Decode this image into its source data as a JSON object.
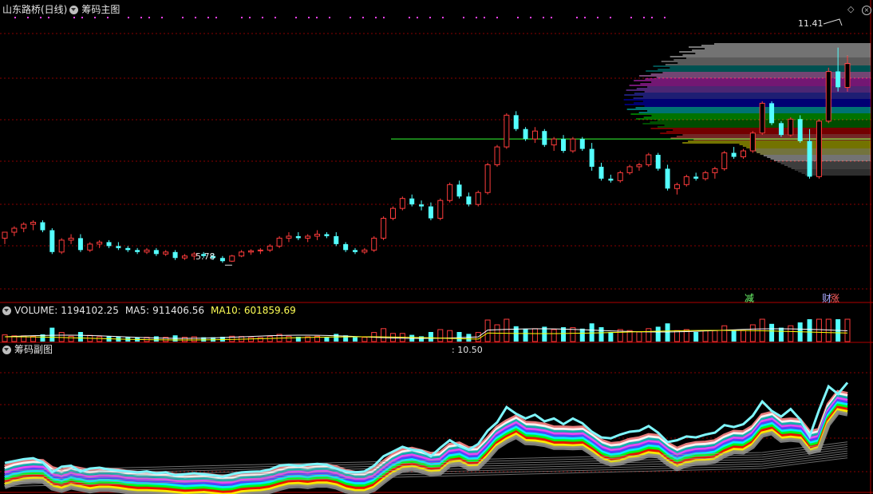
{
  "header": {
    "stock_name": "山东路桥(日线)",
    "main_indicator": "筹码主图",
    "price_high_label": "11.41",
    "price_low_label": "5.78",
    "signal_left": "减",
    "signal_right_a": "财",
    "signal_right_b": "涨"
  },
  "volume_panel": {
    "label_volume": "VOLUME:",
    "volume_value": "1194102.25",
    "label_ma5": "MA5:",
    "ma5_value": "911406.56",
    "label_ma10": "MA10:",
    "ma10_value": "601859.69"
  },
  "sub_panel": {
    "title": "筹码副图",
    "value_label": ": 10.50"
  },
  "colors": {
    "up": "#ff3c3c",
    "down": "#54ffff",
    "grid": "#8a0000",
    "border": "#b00000",
    "cyan_line": "#7ff7ff",
    "magenta_dots": "#ff40ff"
  },
  "chart_data": {
    "type": "candlestick",
    "y_range": [
      5.0,
      11.8
    ],
    "low_marker": 5.78,
    "high_marker": 11.41,
    "avg_cost_line": 8.9,
    "candles": [
      [
        6.4,
        6.55,
        6.25,
        6.55
      ],
      [
        6.55,
        6.7,
        6.45,
        6.65
      ],
      [
        6.65,
        6.8,
        6.55,
        6.75
      ],
      [
        6.75,
        6.85,
        6.6,
        6.8
      ],
      [
        6.8,
        6.85,
        6.55,
        6.6
      ],
      [
        6.6,
        6.65,
        6.0,
        6.05
      ],
      [
        6.05,
        6.4,
        6.0,
        6.35
      ],
      [
        6.35,
        6.5,
        6.25,
        6.4
      ],
      [
        6.4,
        6.5,
        6.05,
        6.1
      ],
      [
        6.1,
        6.3,
        6.05,
        6.25
      ],
      [
        6.25,
        6.35,
        6.15,
        6.3
      ],
      [
        6.3,
        6.35,
        6.15,
        6.2
      ],
      [
        6.2,
        6.3,
        6.1,
        6.15
      ],
      [
        6.15,
        6.2,
        6.05,
        6.1
      ],
      [
        6.1,
        6.15,
        6.0,
        6.05
      ],
      [
        6.05,
        6.15,
        6.0,
        6.1
      ],
      [
        6.1,
        6.15,
        5.95,
        6.0
      ],
      [
        6.0,
        6.1,
        5.95,
        6.05
      ],
      [
        6.05,
        6.1,
        5.85,
        5.9
      ],
      [
        5.9,
        6.0,
        5.85,
        5.95
      ],
      [
        5.95,
        6.05,
        5.85,
        6.0
      ],
      [
        6.0,
        6.05,
        5.9,
        5.95
      ],
      [
        5.95,
        6.0,
        5.85,
        5.9
      ],
      [
        5.9,
        5.95,
        5.78,
        5.82
      ],
      [
        5.82,
        5.98,
        5.8,
        5.95
      ],
      [
        5.95,
        6.1,
        5.92,
        6.05
      ],
      [
        6.05,
        6.12,
        5.98,
        6.08
      ],
      [
        6.08,
        6.15,
        6.0,
        6.1
      ],
      [
        6.1,
        6.25,
        6.05,
        6.2
      ],
      [
        6.2,
        6.45,
        6.15,
        6.4
      ],
      [
        6.4,
        6.55,
        6.3,
        6.45
      ],
      [
        6.45,
        6.55,
        6.35,
        6.4
      ],
      [
        6.4,
        6.5,
        6.3,
        6.45
      ],
      [
        6.45,
        6.6,
        6.35,
        6.5
      ],
      [
        6.5,
        6.55,
        6.4,
        6.45
      ],
      [
        6.45,
        6.55,
        6.2,
        6.25
      ],
      [
        6.25,
        6.3,
        6.05,
        6.1
      ],
      [
        6.1,
        6.15,
        6.0,
        6.05
      ],
      [
        6.05,
        6.15,
        6.0,
        6.1
      ],
      [
        6.1,
        6.45,
        6.05,
        6.4
      ],
      [
        6.4,
        6.95,
        6.35,
        6.9
      ],
      [
        6.9,
        7.2,
        6.85,
        7.15
      ],
      [
        7.15,
        7.45,
        7.1,
        7.4
      ],
      [
        7.4,
        7.5,
        7.2,
        7.25
      ],
      [
        7.25,
        7.35,
        7.1,
        7.2
      ],
      [
        7.2,
        7.3,
        6.85,
        6.9
      ],
      [
        6.9,
        7.4,
        6.85,
        7.35
      ],
      [
        7.35,
        7.8,
        7.3,
        7.75
      ],
      [
        7.75,
        7.85,
        7.4,
        7.45
      ],
      [
        7.45,
        7.55,
        7.2,
        7.25
      ],
      [
        7.25,
        7.6,
        7.2,
        7.55
      ],
      [
        7.55,
        8.3,
        7.5,
        8.25
      ],
      [
        8.25,
        8.75,
        8.2,
        8.7
      ],
      [
        8.7,
        9.55,
        8.65,
        9.5
      ],
      [
        9.5,
        9.6,
        9.1,
        9.15
      ],
      [
        9.15,
        9.2,
        8.85,
        8.9
      ],
      [
        8.9,
        9.2,
        8.8,
        9.1
      ],
      [
        9.1,
        9.15,
        8.7,
        8.75
      ],
      [
        8.75,
        8.95,
        8.6,
        8.9
      ],
      [
        8.9,
        9.0,
        8.55,
        8.6
      ],
      [
        8.6,
        8.95,
        8.55,
        8.9
      ],
      [
        8.9,
        8.95,
        8.6,
        8.65
      ],
      [
        8.65,
        8.8,
        8.1,
        8.2
      ],
      [
        8.2,
        8.3,
        7.85,
        7.9
      ],
      [
        7.9,
        8.0,
        7.8,
        7.85
      ],
      [
        7.85,
        8.1,
        7.8,
        8.05
      ],
      [
        8.05,
        8.25,
        8.0,
        8.2
      ],
      [
        8.2,
        8.3,
        8.1,
        8.25
      ],
      [
        8.25,
        8.55,
        8.2,
        8.5
      ],
      [
        8.5,
        8.55,
        8.1,
        8.15
      ],
      [
        8.15,
        8.25,
        7.6,
        7.65
      ],
      [
        7.65,
        7.8,
        7.5,
        7.75
      ],
      [
        7.75,
        8.0,
        7.7,
        7.95
      ],
      [
        7.95,
        8.05,
        7.85,
        7.9
      ],
      [
        7.9,
        8.1,
        7.85,
        8.05
      ],
      [
        8.05,
        8.2,
        7.9,
        8.15
      ],
      [
        8.15,
        8.6,
        8.1,
        8.55
      ],
      [
        8.55,
        8.7,
        8.4,
        8.45
      ],
      [
        8.45,
        8.65,
        8.4,
        8.6
      ],
      [
        8.6,
        9.1,
        8.55,
        9.05
      ],
      [
        9.05,
        9.85,
        9.0,
        9.8
      ],
      [
        9.8,
        9.85,
        9.25,
        9.3
      ],
      [
        9.3,
        9.35,
        8.95,
        9.0
      ],
      [
        9.0,
        9.45,
        8.95,
        9.4
      ],
      [
        9.4,
        9.5,
        8.8,
        8.85
      ],
      [
        8.85,
        9.15,
        7.9,
        7.95
      ],
      [
        7.95,
        9.4,
        7.9,
        9.35
      ],
      [
        9.35,
        10.7,
        9.3,
        10.6
      ],
      [
        10.6,
        11.2,
        10.1,
        10.2
      ],
      [
        10.2,
        11.0,
        10.1,
        10.8
      ]
    ]
  }
}
